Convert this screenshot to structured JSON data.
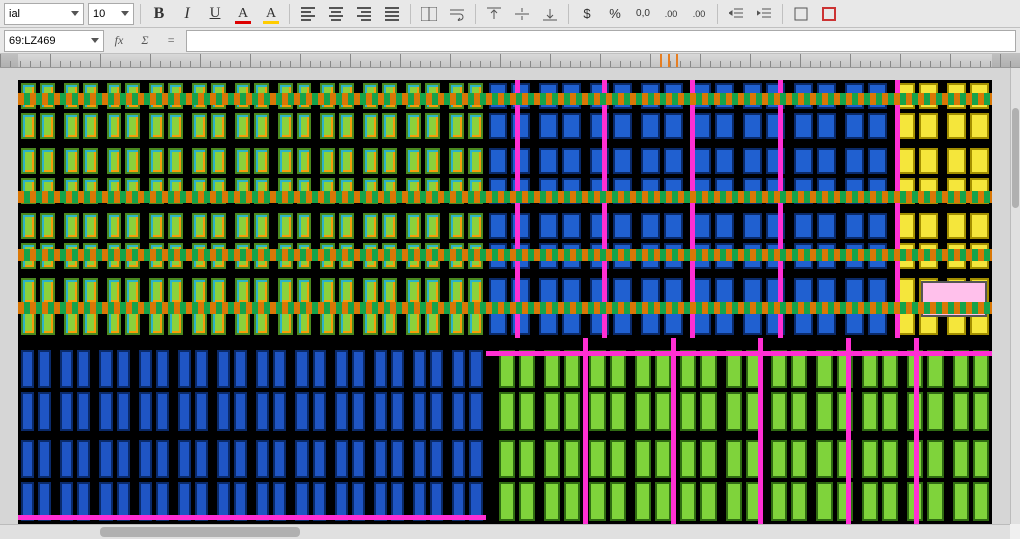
{
  "toolbar": {
    "font_name": "ial",
    "font_size": "10",
    "bold": "B",
    "italic": "I",
    "underline": "U",
    "font_color_glyph": "A",
    "highlight_glyph": "A",
    "currency": "$",
    "percent": "%",
    "number_format": "0,0",
    "add_decimal": ".00",
    "remove_decimal": ".00"
  },
  "formula_bar": {
    "name_box": "69:LZ469",
    "fx_label": "fx",
    "sigma_label": "Σ",
    "equals_label": "=",
    "input_value": ""
  },
  "ruler": {
    "marker_positions": [
      660,
      668,
      676
    ],
    "ticks_every": 10
  },
  "canvas": {
    "quadrants": {
      "top_left": {
        "palette": "green",
        "cols": 11,
        "rows": 4
      },
      "top_right": {
        "palette": "blue",
        "cols": 10,
        "rows": 4,
        "yellow_cols_right": 2,
        "pink_box": true
      },
      "bottom_left": {
        "palette": "blue2",
        "cols": 12,
        "rows": 2
      },
      "bottom_right": {
        "palette": "green2",
        "cols": 11,
        "rows": 2
      }
    },
    "horizontal_bands_pct": [
      3,
      25,
      38,
      50
    ],
    "magenta": {
      "vertical_x_pct_tr": [
        51,
        60,
        69,
        78,
        90
      ],
      "vertical_x_pct_br": [
        58,
        67,
        76,
        85,
        92
      ],
      "horizontal_y_pct_bl": [
        95
      ],
      "horizontal_y_pct_br": [
        61
      ]
    }
  },
  "accent_colors": {
    "green": "#8bd13b",
    "blue": "#2060d0",
    "yellow": "#f5e63b",
    "magenta": "#ff2fd3",
    "orange": "#d97706",
    "pink": "#ffc0eb"
  }
}
